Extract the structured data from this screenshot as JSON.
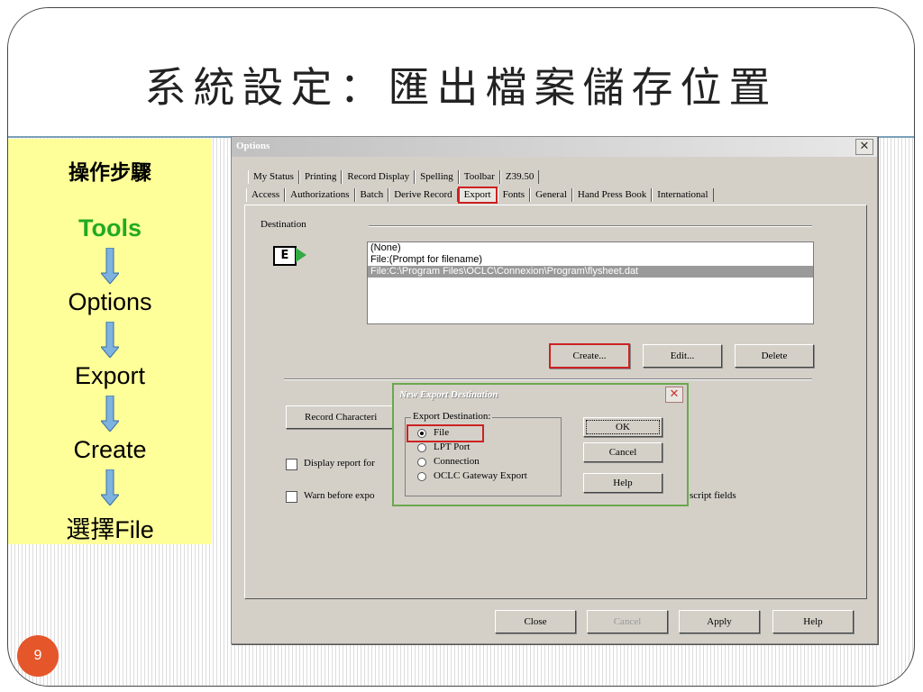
{
  "slide": {
    "title": "系統設定：匯出檔案儲存位置",
    "page_number": "9"
  },
  "steps": {
    "heading": "操作步驟",
    "items": [
      "Tools",
      "Options",
      "Export",
      "Create",
      "選擇File"
    ],
    "highlight_color": "#22aa22",
    "arrow_color": "#7eb3e0"
  },
  "options_dialog": {
    "title": "Options",
    "tabs_row1": [
      "My Status",
      "Printing",
      "Record Display",
      "Spelling",
      "Toolbar",
      "Z39.50"
    ],
    "tabs_row2": [
      "Access",
      "Authorizations",
      "Batch",
      "Derive Record",
      "Export",
      "Fonts",
      "General",
      "Hand Press Book",
      "International"
    ],
    "active_tab": "Export",
    "destination_label": "Destination",
    "destinations": [
      "(None)",
      "File:(Prompt for filename)",
      "File:C:\\Program Files\\OCLC\\Connexion\\Program\\flysheet.dat"
    ],
    "selected_destination": 2,
    "create_button": "Create...",
    "edit_button": "Edit...",
    "delete_button": "Delete",
    "record_characteristics_button": "Record Characteri",
    "display_report_label": "Display report for",
    "warn_label": "Warn before expo",
    "script_fields_label": "script fields",
    "close_button": "Close",
    "cancel_button": "Cancel",
    "apply_button": "Apply",
    "help_button": "Help"
  },
  "new_export_dialog": {
    "title": "New Export Destination",
    "group_label": "Export Destination:",
    "options": [
      "File",
      "LPT Port",
      "Connection",
      "OCLC Gateway Export"
    ],
    "selected_option": 0,
    "ok_button": "OK",
    "cancel_button": "Cancel",
    "help_button": "Help"
  },
  "colors": {
    "highlight_box": "#cc2222",
    "step_panel": "#ffff99",
    "page_badge": "#e5562a"
  }
}
